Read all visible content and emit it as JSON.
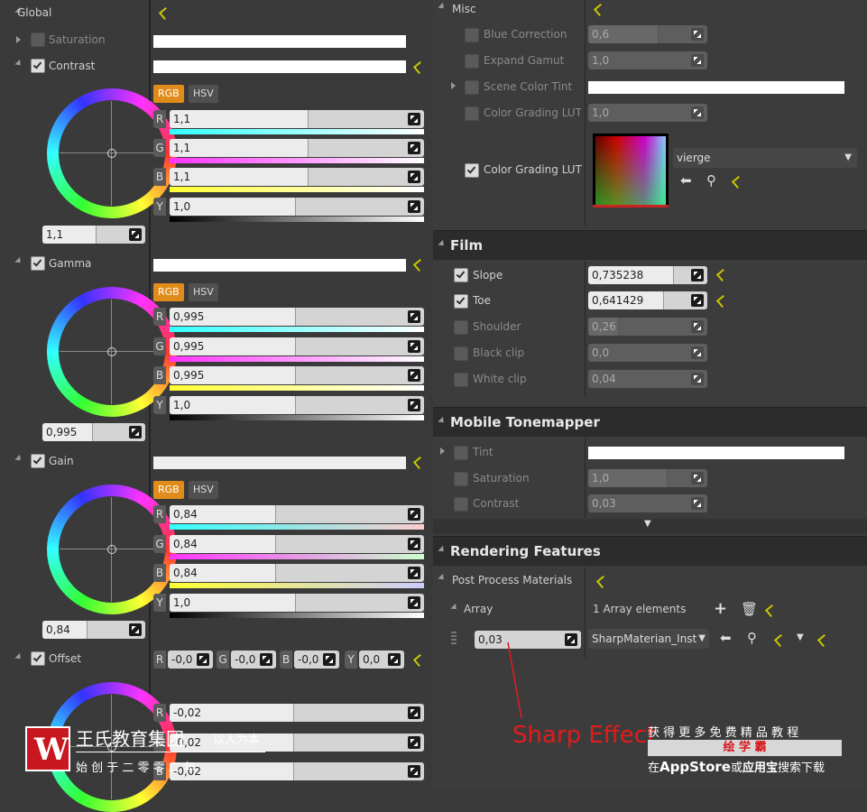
{
  "left": {
    "global_label": "Global",
    "saturation_label": "Saturation",
    "contrast": {
      "label": "Contrast",
      "rgb": "RGB",
      "hsv": "HSV",
      "r": "1,1",
      "g": "1,1",
      "b": "1,1",
      "y": "1,0",
      "wheel_value": "1,1"
    },
    "gamma": {
      "label": "Gamma",
      "rgb": "RGB",
      "hsv": "HSV",
      "r": "0,995",
      "g": "0,995",
      "b": "0,995",
      "y": "1,0",
      "wheel_value": "0,995"
    },
    "gain": {
      "label": "Gain",
      "rgb": "RGB",
      "hsv": "HSV",
      "r": "0,84",
      "g": "0,84",
      "b": "0,84",
      "y": "1,0",
      "wheel_value": "0,84"
    },
    "offset": {
      "label": "Offset",
      "r": "-0,0",
      "g": "-0,0",
      "b": "-0,0",
      "y": "0,0",
      "r_full": "-0,02",
      "g_full": "-0,02",
      "b_full": "-0,02"
    },
    "channels": {
      "r": "R",
      "g": "G",
      "b": "B",
      "y": "Y"
    }
  },
  "right": {
    "misc": {
      "title": "Misc",
      "blue_correction": {
        "label": "Blue Correction",
        "value": "0,6"
      },
      "expand_gamut": {
        "label": "Expand Gamut",
        "value": "1,0"
      },
      "scene_color_tint": {
        "label": "Scene Color Tint"
      },
      "lut_intensity": {
        "label": "Color Grading LUT I",
        "value": "1,0"
      },
      "lut": {
        "label": "Color Grading LUT",
        "asset": "vierge"
      }
    },
    "film": {
      "title": "Film",
      "slope": {
        "label": "Slope",
        "value": "0,735238"
      },
      "toe": {
        "label": "Toe",
        "value": "0,641429"
      },
      "shoulder": {
        "label": "Shoulder",
        "value": "0,26"
      },
      "black_clip": {
        "label": "Black clip",
        "value": "0,0"
      },
      "white_clip": {
        "label": "White clip",
        "value": "0,04"
      }
    },
    "mobile": {
      "title": "Mobile Tonemapper",
      "tint": {
        "label": "Tint"
      },
      "saturation": {
        "label": "Saturation",
        "value": "1,0"
      },
      "contrast": {
        "label": "Contrast",
        "value": "0,03"
      }
    },
    "rendering": {
      "title": "Rendering Features",
      "ppm_label": "Post Process Materials",
      "array_label": "Array",
      "array_count": "1 Array elements",
      "element_value": "0,03",
      "material": "SharpMaterian_Inst"
    }
  },
  "annotation": "Sharp Effect",
  "watermark": {
    "brand": "王氏教育集团",
    "motto": "以人为本",
    "founded": "始 创 于 二 零 零 二 年",
    "promo": "获 得 更 多 免 费 精 品 教 程",
    "app": "绘 学 霸",
    "store_pre": "在",
    "store_app": "AppStore",
    "store_mid": "或",
    "store_alt": "应用宝",
    "store_post": "搜索下载"
  },
  "colors": {
    "accent": "#e08c1b",
    "reset": "#c8c800",
    "annotation": "#e21b1b"
  }
}
